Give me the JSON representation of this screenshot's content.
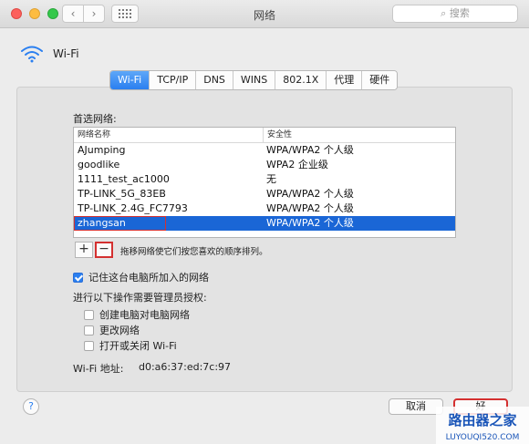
{
  "window": {
    "title": "网络"
  },
  "toolbar": {
    "back_icon": "chevron-left",
    "forward_icon": "chevron-right",
    "grid_icon": "grid",
    "search_placeholder": "搜索"
  },
  "wifi": {
    "title": "Wi-Fi",
    "icon": "wifi-icon"
  },
  "tabs": [
    {
      "label": "Wi-Fi",
      "active": true
    },
    {
      "label": "TCP/IP",
      "active": false
    },
    {
      "label": "DNS",
      "active": false
    },
    {
      "label": "WINS",
      "active": false
    },
    {
      "label": "802.1X",
      "active": false
    },
    {
      "label": "代理",
      "active": false
    },
    {
      "label": "硬件",
      "active": false
    }
  ],
  "preferred": {
    "label": "首选网络:",
    "columns": {
      "name": "网络名称",
      "security": "安全性"
    },
    "rows": [
      {
        "name": "AJumping",
        "security": "WPA/WPA2 个人级",
        "selected": false
      },
      {
        "name": "goodlike",
        "security": "WPA2 企业级",
        "selected": false
      },
      {
        "name": "1111_test_ac1000",
        "security": "无",
        "selected": false
      },
      {
        "name": "TP-LINK_5G_83EB",
        "security": "WPA/WPA2 个人级",
        "selected": false
      },
      {
        "name": "TP-LINK_2.4G_FC7793",
        "security": "WPA/WPA2 个人级",
        "selected": false
      },
      {
        "name": "zhangsan",
        "security": "WPA/WPA2 个人级",
        "selected": true
      }
    ],
    "plus": "+",
    "minus": "−",
    "hint": "拖移网络使它们按您喜欢的顺序排列。"
  },
  "options": {
    "remember": {
      "label": "记住这台电脑所加入的网络",
      "checked": true
    },
    "admin_label": "进行以下操作需要管理员授权:",
    "admin_items": [
      {
        "label": "创建电脑对电脑网络",
        "checked": false
      },
      {
        "label": "更改网络",
        "checked": false
      },
      {
        "label": "打开或关闭 Wi-Fi",
        "checked": false
      }
    ]
  },
  "address": {
    "label": "Wi-Fi 地址:",
    "value": "d0:a6:37:ed:7c:97"
  },
  "footer": {
    "help": "?",
    "cancel": "取消",
    "ok": "好"
  },
  "watermark": {
    "line1": "路由器之家",
    "line2": "LUYOUQI520.COM"
  },
  "colors": {
    "accent": "#2a7ff0",
    "selection": "#1a66d6",
    "highlight_red": "#d43030"
  }
}
